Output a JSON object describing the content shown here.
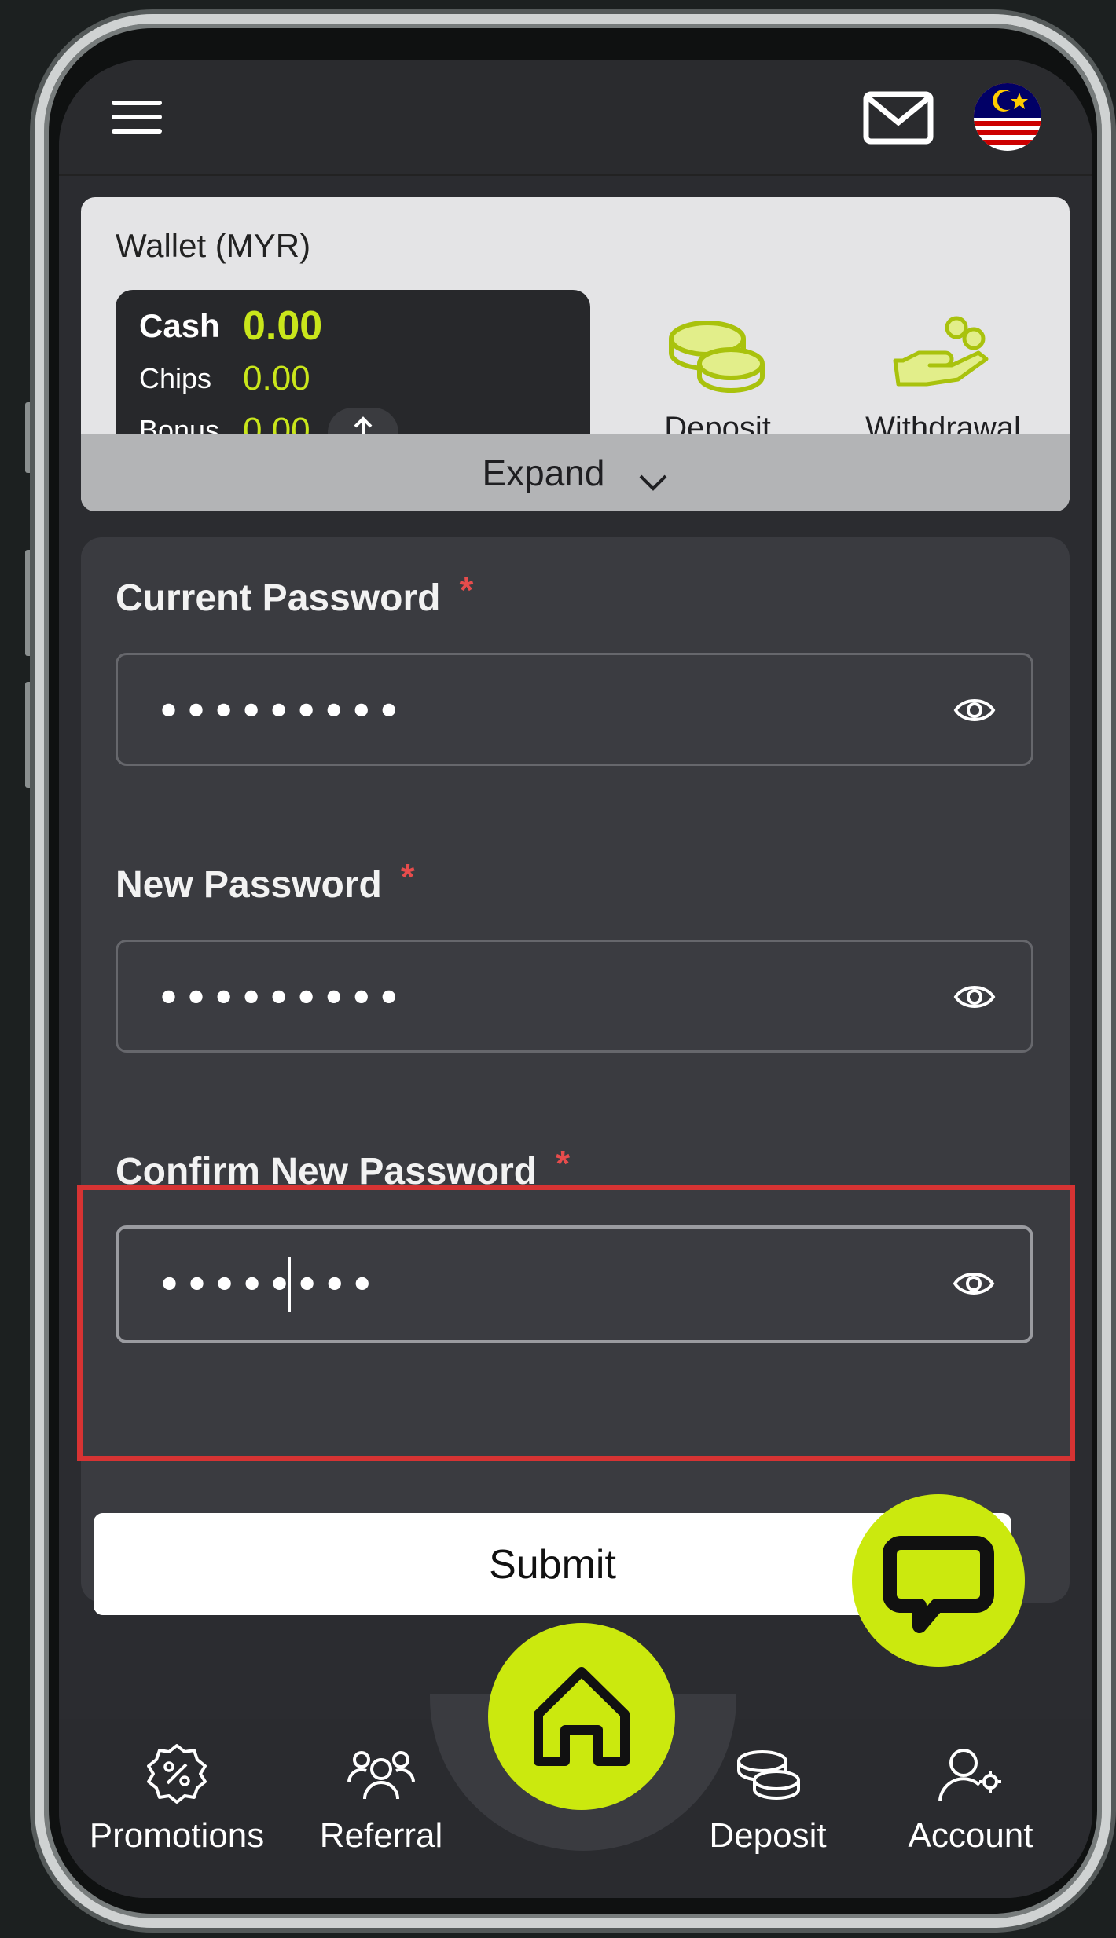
{
  "topbar": {
    "menu_icon": "hamburger-icon",
    "mail_icon": "mail-icon",
    "flag_icon": "malaysia-flag-icon"
  },
  "wallet": {
    "title": "Wallet (MYR)",
    "cash_label": "Cash",
    "cash_value": "0.00",
    "chips_label": "Chips",
    "chips_value": "0.00",
    "bonus_label": "Bonus",
    "bonus_value": "0.00",
    "deposit_label": "Deposit",
    "withdrawal_label": "Withdrawal",
    "expand_label": "Expand"
  },
  "form": {
    "current_password_label": "Current Password",
    "current_password_value": "•••••••••",
    "new_password_label": "New Password",
    "new_password_value": "•••••••••",
    "confirm_password_label": "Confirm New Password",
    "confirm_password_value": "••••••••",
    "required_mark": "*",
    "submit_label": "Submit"
  },
  "bottom_nav": {
    "items": [
      {
        "label": "Promotions",
        "icon": "promotion-badge-icon"
      },
      {
        "label": "Referral",
        "icon": "referral-users-icon"
      },
      {
        "label": "Deposit",
        "icon": "coins-icon"
      },
      {
        "label": "Account",
        "icon": "account-settings-icon"
      }
    ],
    "home_icon": "home-icon"
  },
  "colors": {
    "accent": "#cbe90e",
    "highlight_border": "#d63333",
    "required": "#e74c4c"
  }
}
